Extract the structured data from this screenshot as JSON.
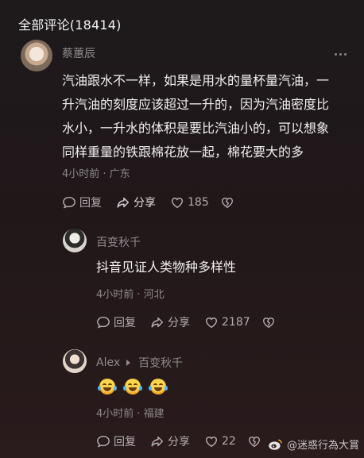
{
  "header": {
    "title": "全部评论(18414)"
  },
  "comments": [
    {
      "author": "蔡蕙辰",
      "text_lines": [
        "汽油跟水不一样，如果是用水的量杯量汽油，一",
        "升汽油的刻度应该超过一升的，因为汽油密度比",
        "水小，一升水的体积是要比汽油小的，可以想象",
        "同样重量的铁跟棉花放一起，棉花要大的多"
      ],
      "meta": "4小时前 · 广东",
      "reply_label": "回复",
      "share_label": "分享",
      "likes": "185"
    },
    {
      "author": "百变秋千",
      "text_lines": [
        "抖音见证人类物种多样性"
      ],
      "meta": "4小时前 · 河北",
      "reply_label": "回复",
      "share_label": "分享",
      "likes": "2187"
    },
    {
      "author": "Alex",
      "reply_to": "百变秋千",
      "emojis": [
        "laugh-cry-emoji",
        "laugh-cry-emoji",
        "laugh-cry-emoji"
      ],
      "meta": "4小时前 · 福建",
      "reply_label": "回复",
      "share_label": "分享",
      "likes": "22"
    }
  ],
  "watermark": {
    "text": "@迷惑行為大賞"
  },
  "colors": {
    "background": "#201719",
    "text": "#f1efef",
    "muted": "#8c8789"
  }
}
